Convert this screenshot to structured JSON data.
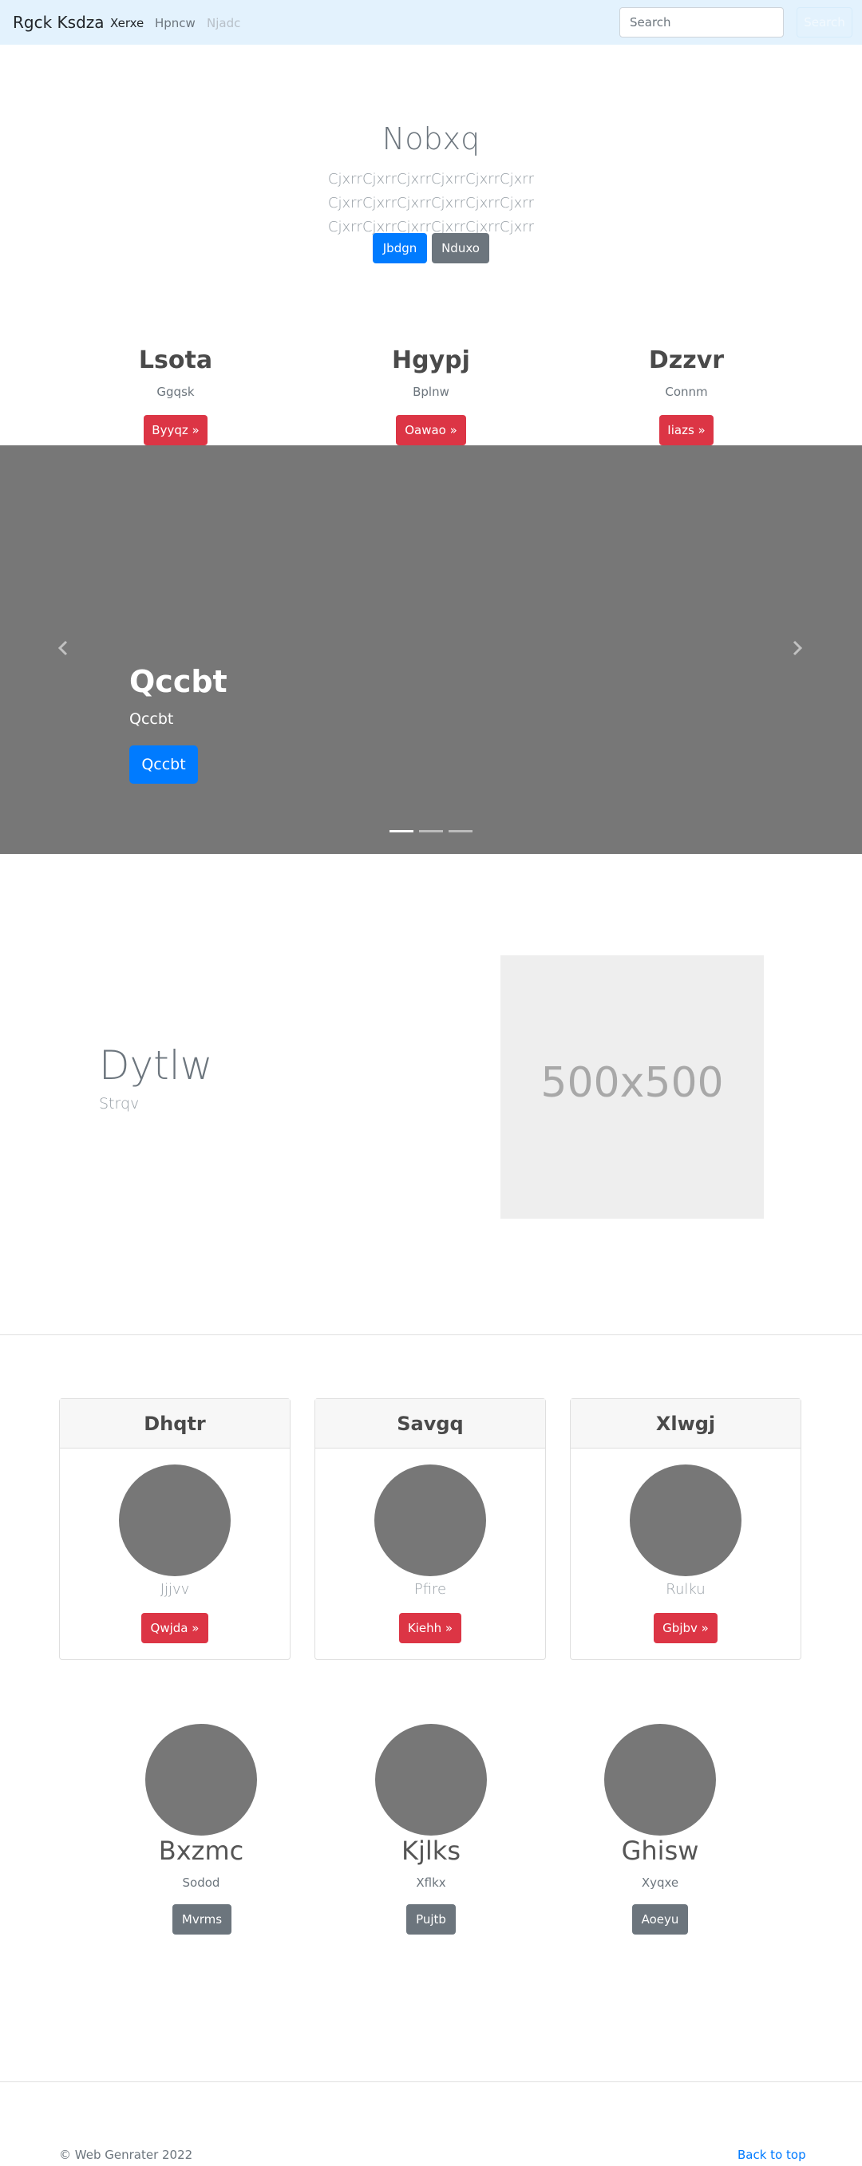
{
  "navbar": {
    "brand": "Rgck Ksdza",
    "links": [
      "Xerxe",
      "Hpncw",
      "Njadc"
    ],
    "search_placeholder": "Search",
    "search_button": "Search"
  },
  "hero": {
    "title": "Nobxq",
    "lead": "CjxrrCjxrrCjxrrCjxrrCjxrrCjxrr CjxrrCjxrrCjxrrCjxrrCjxrrCjxrr CjxrrCjxrrCjxrrCjxrrCjxrrCjxrr",
    "primary_button": "Jbdgn",
    "secondary_button": "Nduxo"
  },
  "columns": [
    {
      "heading": "Lsota",
      "text": "Ggqsk",
      "button": "Byyqz »"
    },
    {
      "heading": "Hgypj",
      "text": "Bplnw",
      "button": "Oawao »"
    },
    {
      "heading": "Dzzvr",
      "text": "Connm",
      "button": "Iiazs »"
    }
  ],
  "carousel": {
    "prev_icon": "chevron-left-icon",
    "next_icon": "chevron-right-icon",
    "title": "Qccbt",
    "subtitle": "Qccbt",
    "button": "Qccbt",
    "indicator_count": 3,
    "active_indicator": 1
  },
  "featurette": {
    "title": "Dytlw",
    "subtitle": "Strqv",
    "image_label": "500x500"
  },
  "cards": [
    {
      "header": "Dhqtr",
      "text": "Jjjvv",
      "button": "Qwjda »"
    },
    {
      "header": "Savgq",
      "text": "Pfire",
      "button": "Kiehh »"
    },
    {
      "header": "Xlwgj",
      "text": "Rulku",
      "button": "Gbjbv »"
    }
  ],
  "circles": [
    {
      "name": "Bxzmc",
      "text": "Sodod",
      "button": "Mvrms"
    },
    {
      "name": "Kjlks",
      "text": "Xflkx",
      "button": "Pujtb"
    },
    {
      "name": "Ghisw",
      "text": "Xyqxe",
      "button": "Aoeyu"
    }
  ],
  "footer": {
    "copyright": "© Web Genrater 2022",
    "back_to_top": "Back to top"
  },
  "colors": {
    "navbar_bg": "#e3f2fd",
    "primary": "#007bff",
    "secondary": "#6c757d",
    "danger": "#dc3545",
    "carousel_bg": "#777777",
    "placeholder_bg": "#eeeeee"
  }
}
